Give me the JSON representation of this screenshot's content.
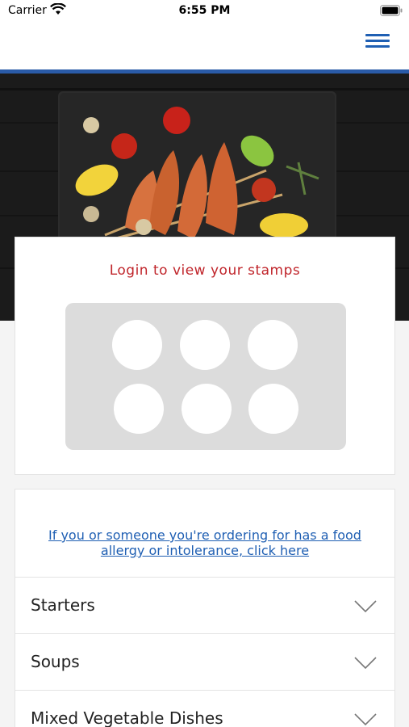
{
  "status_bar": {
    "carrier": "Carrier",
    "time": "6:55 PM"
  },
  "header": {
    "menu_icon": "hamburger-icon",
    "accent_color": "#2a5ba8"
  },
  "hero": {
    "image": "grilled-prawn-skewers-photo"
  },
  "stamps": {
    "title": "Login to view your stamps",
    "title_color": "#c0252b",
    "count": 6,
    "filled": 0
  },
  "menu": {
    "allergy_link": "If you or someone you're ordering for has a food allergy or intolerance, click here",
    "link_color": "#1f5fb3",
    "categories": [
      {
        "label": "Starters",
        "icon": "chevron-down-icon"
      },
      {
        "label": "Soups",
        "icon": "chevron-down-icon"
      },
      {
        "label": "Mixed Vegetable Dishes",
        "icon": "chevron-down-icon"
      }
    ]
  }
}
